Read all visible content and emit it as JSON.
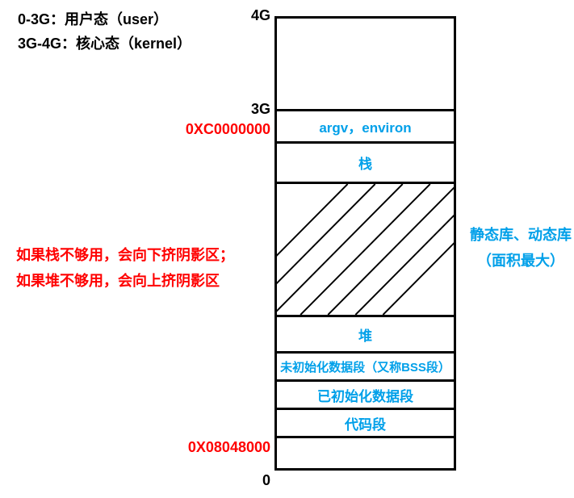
{
  "legend": {
    "line1": "0-3G：用户态（user）",
    "line2": "3G-4G：核心态（kernel）"
  },
  "addresses": {
    "top": "4G",
    "three_g": "3G",
    "three_g_hex": "0XC0000000",
    "code_hex": "0X08048000",
    "bottom": "0"
  },
  "segments": {
    "kernel": "",
    "argv": "argv，environ",
    "stack": "栈",
    "libs": "",
    "heap": "堆",
    "bss": "未初始化数据段（又称BSS段）",
    "data": "已初始化数据段",
    "text": "代码段",
    "reserved": ""
  },
  "notes": {
    "left_line1": "如果栈不够用，会向下挤阴影区；",
    "left_line2": "如果堆不够用，会向上挤阴影区",
    "right_line1": "静态库、动态库",
    "right_line2": "（面积最大）"
  },
  "chart_data": {
    "type": "table",
    "title": "Process Virtual Memory Layout (0 – 4G)",
    "regions": [
      {
        "name": "kernel space",
        "range": "3G – 4G",
        "start_hex": "0xC0000000",
        "label": "核心态（kernel）"
      },
      {
        "name": "argv / environ",
        "range": "just below 3G",
        "label": "argv，environ"
      },
      {
        "name": "stack",
        "label": "栈",
        "grows": "down"
      },
      {
        "name": "memory-mapping / libraries (hatched)",
        "label": "静态库、动态库（面积最大）"
      },
      {
        "name": "heap",
        "label": "堆",
        "grows": "up"
      },
      {
        "name": "BSS segment",
        "label": "未初始化数据段（又称BSS段）"
      },
      {
        "name": "initialized data segment",
        "label": "已初始化数据段"
      },
      {
        "name": "text / code segment",
        "label": "代码段",
        "start_hex": "0x08048000"
      },
      {
        "name": "reserved",
        "range": "0 – 0x08048000"
      }
    ],
    "annotations": [
      "0-3G：用户态（user）",
      "3G-4G：核心态（kernel）",
      "如果栈不够用，会向下挤阴影区；如果堆不够用，会向上挤阴影区"
    ]
  }
}
